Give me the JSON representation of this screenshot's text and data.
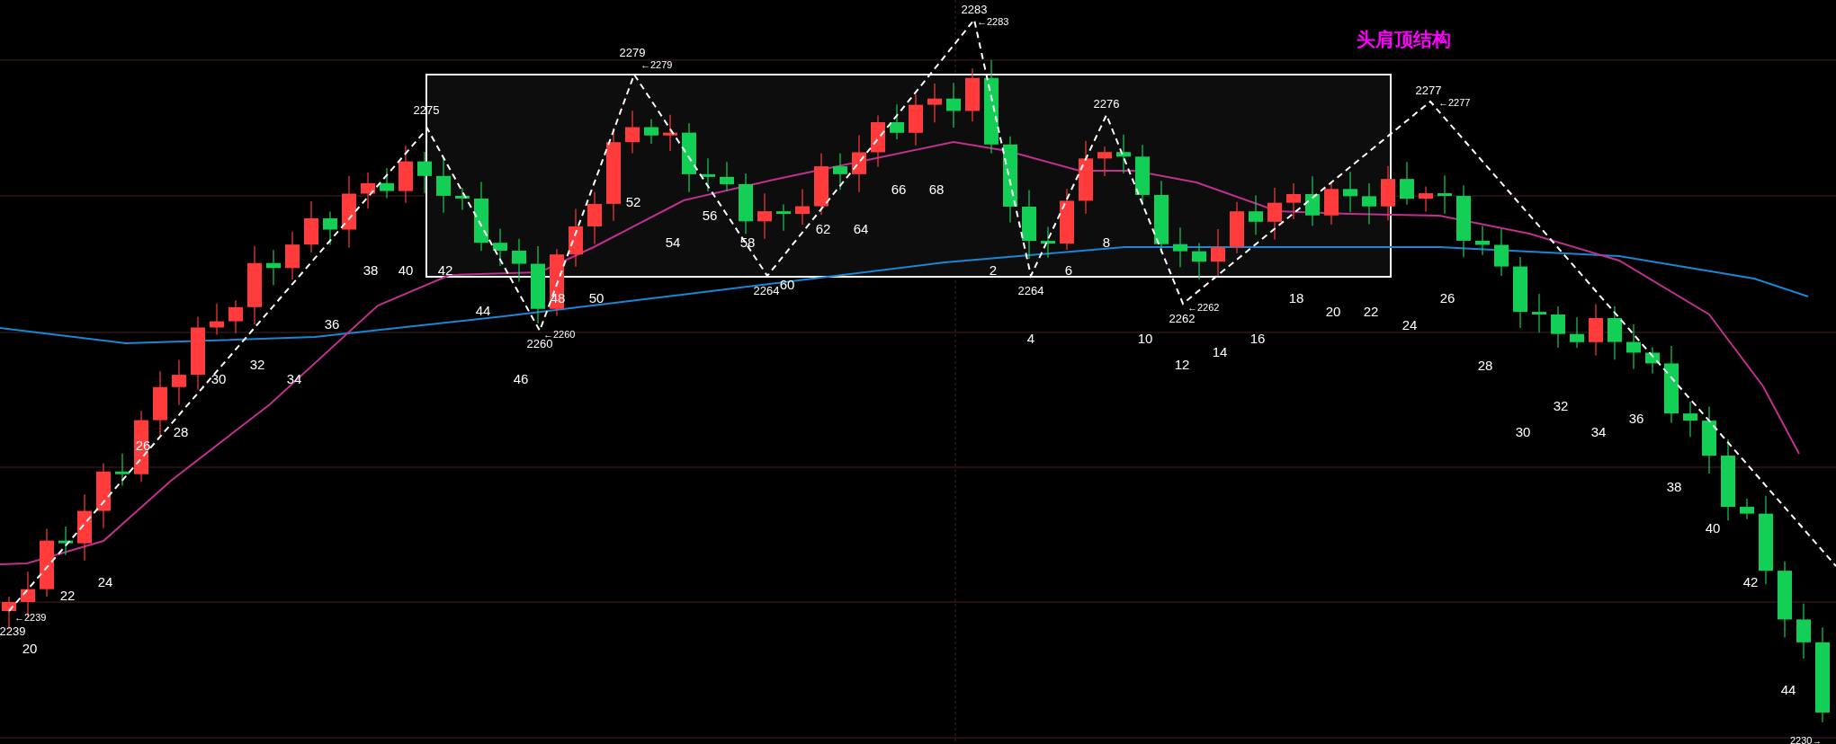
{
  "title": "头肩顶结构",
  "pivots": [
    {
      "price": "2239",
      "marker": "←2239"
    },
    {
      "price": "2275"
    },
    {
      "price": "2260",
      "marker": "←2260"
    },
    {
      "price": "2279",
      "marker": "←2279"
    },
    {
      "price": "2264"
    },
    {
      "price": "2283",
      "marker": "←2283"
    },
    {
      "price": "2264"
    },
    {
      "price": "2276"
    },
    {
      "price": "2262",
      "marker": "←2262"
    },
    {
      "price": "2277",
      "marker": "←2277"
    },
    {
      "marker": "2230→"
    }
  ],
  "bar_counts": [
    "20",
    "22",
    "24",
    "26",
    "28",
    "30",
    "32",
    "34",
    "36",
    "38",
    "40",
    "42",
    "44",
    "46",
    "48",
    "50",
    "52",
    "54",
    "56",
    "58",
    "60",
    "62",
    "64",
    "66",
    "68",
    "2",
    "4",
    "6",
    "8",
    "10",
    "12",
    "14",
    "16",
    "18",
    "20",
    "22",
    "24",
    "26",
    "28",
    "30",
    "32",
    "34",
    "36",
    "38",
    "40",
    "42",
    "44"
  ]
}
